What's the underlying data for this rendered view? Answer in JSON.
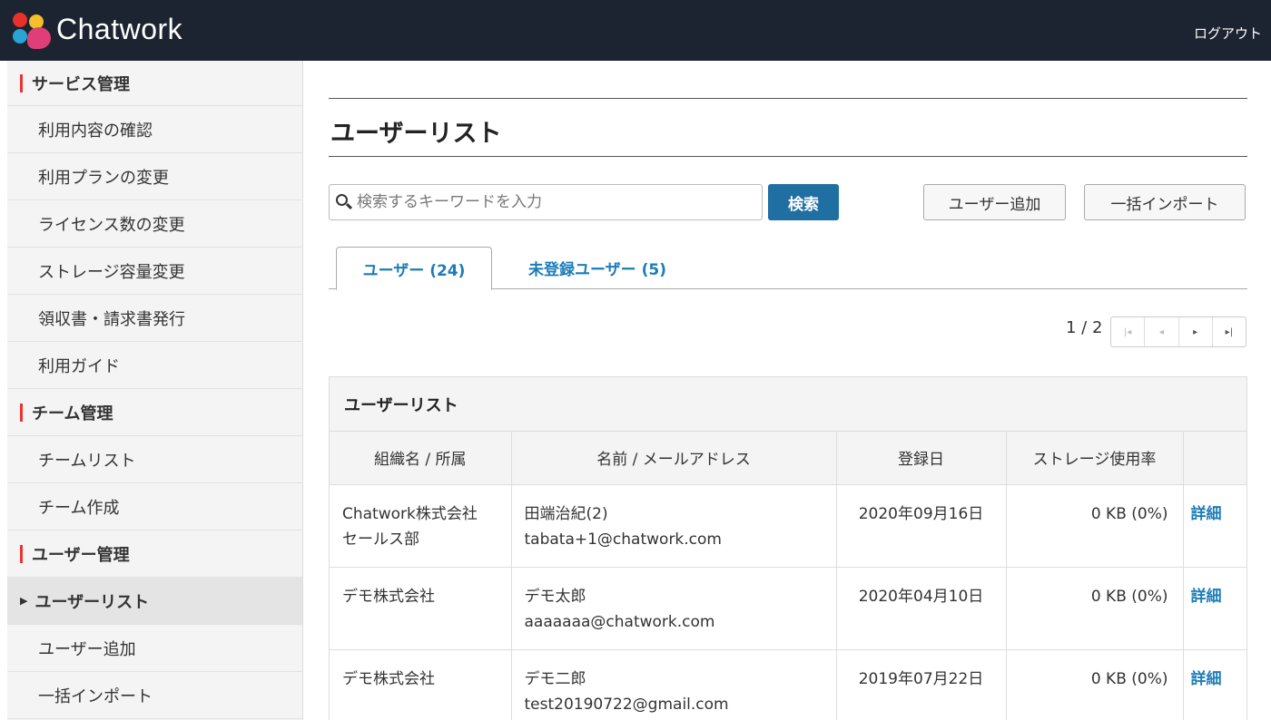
{
  "header": {
    "brand": "Chatwork",
    "logout": "ログアウト"
  },
  "sidebar": {
    "sections": [
      {
        "title": "サービス管理",
        "items": [
          "利用内容の確認",
          "利用プランの変更",
          "ライセンス数の変更",
          "ストレージ容量変更",
          "領収書・請求書発行",
          "利用ガイド"
        ]
      },
      {
        "title": "チーム管理",
        "items": [
          "チームリスト",
          "チーム作成"
        ]
      },
      {
        "title": "ユーザー管理",
        "items": [
          "ユーザーリスト",
          "ユーザー追加",
          "一括インポート"
        ]
      }
    ],
    "active_item": "ユーザーリスト"
  },
  "main": {
    "title": "ユーザーリスト",
    "search": {
      "placeholder": "検索するキーワードを入力",
      "value": "",
      "button": "検索"
    },
    "add_user_button": "ユーザー追加",
    "bulk_import_button": "一括インポート",
    "tabs": [
      {
        "label": "ユーザー (24)",
        "active": true
      },
      {
        "label": "未登録ユーザー (5)",
        "active": false
      }
    ],
    "pagination": {
      "label": "1 / 2",
      "first": "|◂",
      "prev": "◂",
      "next": "▸",
      "last": "▸|"
    },
    "panel": {
      "title": "ユーザーリスト",
      "columns": [
        "組織名 / 所属",
        "名前 / メールアドレス",
        "登録日",
        "ストレージ使用率",
        ""
      ],
      "rows": [
        {
          "org": "Chatwork株式会社",
          "dept": "セールス部",
          "name": "田端治紀(2)",
          "email": "tabata+1@chatwork.com",
          "date": "2020年09月16日",
          "storage": "0 KB (0%)",
          "detail": "詳細"
        },
        {
          "org": "デモ株式会社",
          "dept": "",
          "name": "デモ太郎",
          "email": "aaaaaaa@chatwork.com",
          "date": "2020年04月10日",
          "storage": "0 KB (0%)",
          "detail": "詳細"
        },
        {
          "org": "デモ株式会社",
          "dept": "",
          "name": "デモ二郎",
          "email": "test20190722@gmail.com",
          "date": "2019年07月22日",
          "storage": "0 KB (0%)",
          "detail": "詳細"
        }
      ]
    }
  },
  "colors": {
    "topbar": "#1c2431",
    "accent": "#1f6fa3",
    "link": "#1c7cb8",
    "section_mark": "#e33333"
  }
}
